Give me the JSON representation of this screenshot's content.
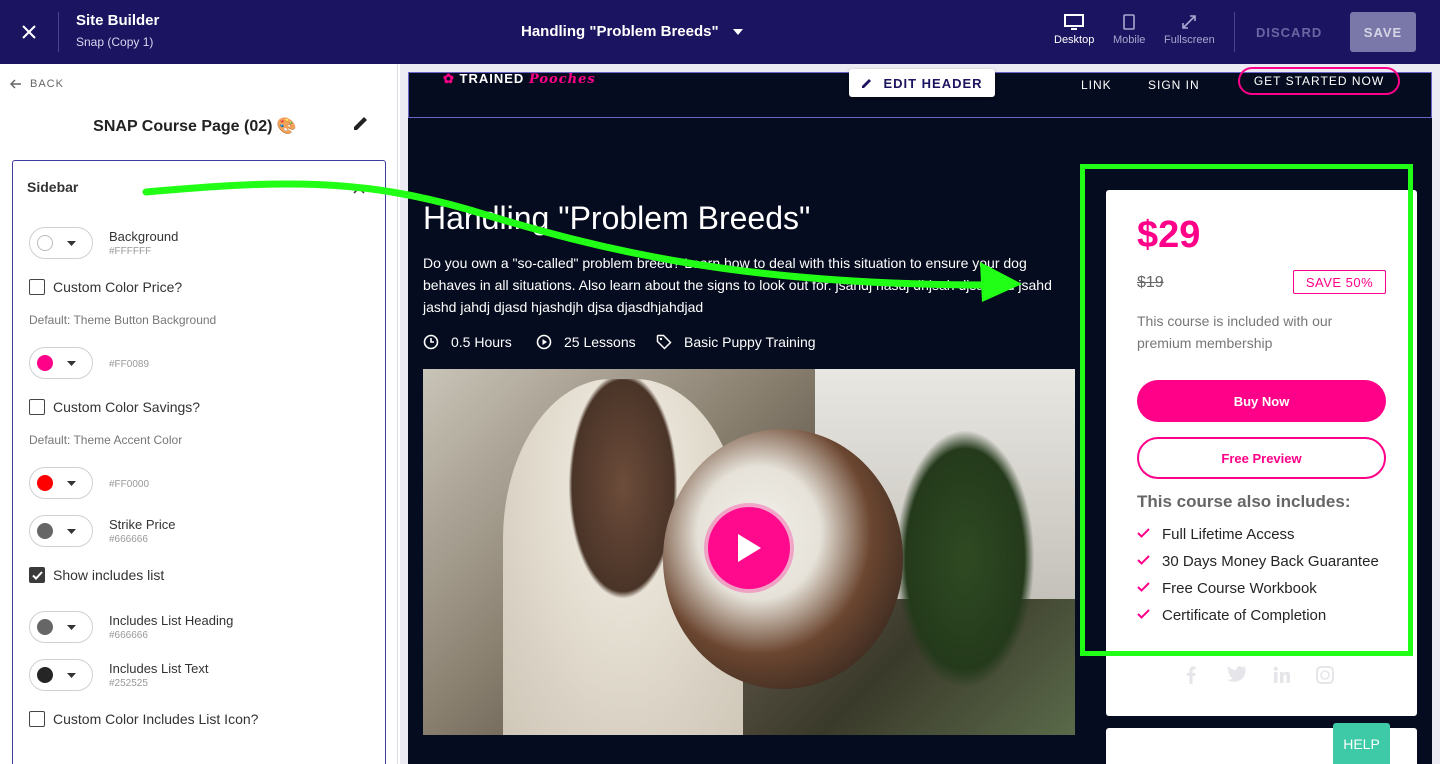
{
  "topbar": {
    "app_title": "Site Builder",
    "app_subtitle": "Snap (Copy 1)",
    "page_selector": "Handling \"Problem Breeds\"",
    "views": [
      {
        "label": "Desktop",
        "icon": "desktop-icon",
        "active": true
      },
      {
        "label": "Mobile",
        "icon": "mobile-icon",
        "active": false
      },
      {
        "label": "Fullscreen",
        "icon": "fullscreen-icon",
        "active": false
      }
    ],
    "discard_label": "DISCARD",
    "save_label": "SAVE"
  },
  "left_panel": {
    "back_label": "BACK",
    "page_name": "SNAP Course Page (02) 🎨",
    "section": {
      "title": "Sidebar",
      "background": {
        "name": "Background",
        "hex": "#FFFFFF",
        "color": "#FFFFFF"
      },
      "custom_color_price": {
        "label": "Custom Color Price?",
        "checked": false,
        "hint": "Default: Theme Button Background"
      },
      "price_color": {
        "hex": "#FF0089",
        "color": "#FF0089"
      },
      "custom_color_savings": {
        "label": "Custom Color Savings?",
        "checked": false,
        "hint": "Default: Theme Accent Color"
      },
      "savings_color": {
        "hex": "#FF0000",
        "color": "#FF0000"
      },
      "strike_price": {
        "name": "Strike Price",
        "hex": "#666666",
        "color": "#666666"
      },
      "show_includes": {
        "label": "Show includes list",
        "checked": true
      },
      "includes_heading": {
        "name": "Includes List Heading",
        "hex": "#666666",
        "color": "#666666"
      },
      "includes_text": {
        "name": "Includes List Text",
        "hex": "#252525",
        "color": "#252525"
      },
      "custom_color_icon": {
        "label": "Custom Color Includes List Icon?",
        "checked": false
      }
    }
  },
  "site": {
    "logo": {
      "line1": "TRAINED",
      "script": "Pooches"
    },
    "edit_header_label": "EDIT HEADER",
    "nav": {
      "link": "LINK",
      "sign_in": "SIGN IN",
      "cta": "GET STARTED NOW"
    },
    "course": {
      "title": "Handling \"Problem Breeds\"",
      "description": "Do you own a \"so-called\" problem breed? Learn how to deal with this situation to ensure your dog behaves in all situations. Also learn about the signs to look out for. jsahdj hasdj dhjsah djsad jhd jsahd jashd jahdj djasd hjashdjh djsa djasdhjahdjad",
      "hours": "0.5 Hours",
      "lessons": "25 Lessons",
      "category": "Basic Puppy Training"
    },
    "pricing": {
      "price": "$29",
      "strike_price": "$19",
      "save_badge": "SAVE 50%",
      "membership_note": "This course is included with our premium membership",
      "buy_label": "Buy Now",
      "preview_label": "Free Preview",
      "includes_heading": "This course also includes:",
      "includes": [
        "Full Lifetime Access",
        "30 Days Money Back Guarantee",
        "Free Course Workbook",
        "Certificate of Completion"
      ],
      "social_icons": [
        "facebook-icon",
        "twitter-icon",
        "linkedin-icon",
        "whatsapp-icon"
      ]
    }
  },
  "help_label": "HELP",
  "colors": {
    "brand": "#1b1460",
    "accent": "#ff0089",
    "annotation": "#22ff16",
    "help": "#3ec9a7"
  }
}
